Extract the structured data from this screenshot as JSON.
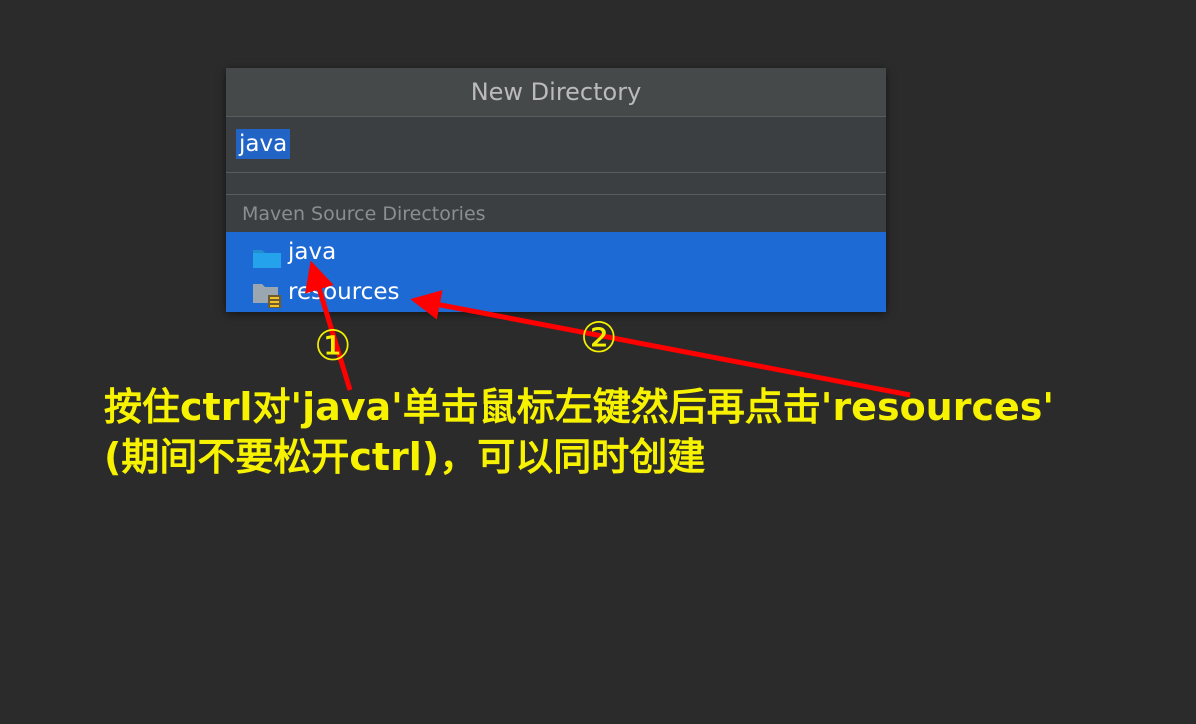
{
  "dialog": {
    "title": "New Directory",
    "input_value": "java",
    "section_header": "Maven Source Directories",
    "items": [
      {
        "label": "java",
        "icon": "folder-icon"
      },
      {
        "label": "resources",
        "icon": "resources-folder-icon"
      }
    ]
  },
  "annotation": {
    "marker_1": "①",
    "marker_2": "②",
    "instruction_line_1": "按住ctrl对'java'单击鼠标左键然后再点击'resources'",
    "instruction_line_2": "(期间不要松开ctrl)，可以同时创建"
  },
  "colors": {
    "background": "#2b2b2b",
    "dialog_bg": "#3c3f41",
    "selection": "#1e6ad4",
    "input_selection": "#2164c6",
    "arrow": "#ff0000",
    "annotation_text": "#f7f200"
  }
}
